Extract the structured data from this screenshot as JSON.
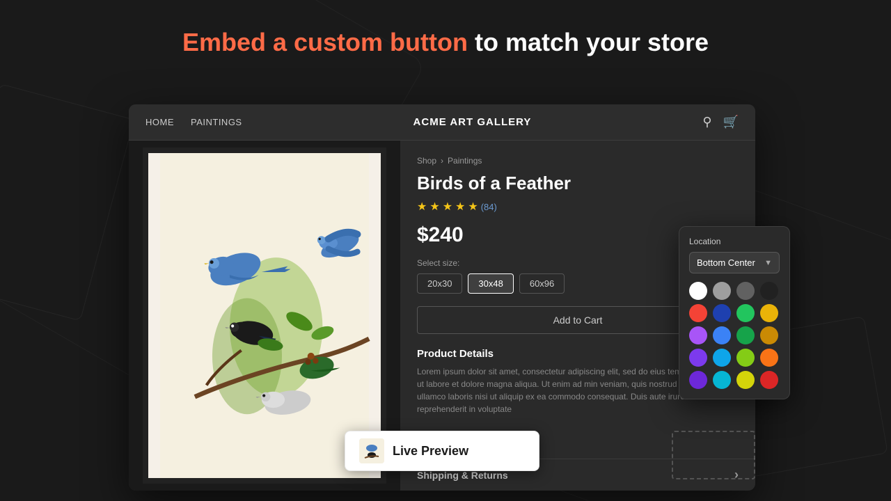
{
  "page": {
    "background_color": "#1a1a1a"
  },
  "hero": {
    "title_accent": "Embed a custom button",
    "title_rest": " to match your store"
  },
  "store": {
    "nav": {
      "link1": "HOME",
      "link2": "PAINTINGS",
      "title": "ACME ART GALLERY"
    },
    "product": {
      "breadcrumb_shop": "Shop",
      "breadcrumb_sep": "›",
      "breadcrumb_cat": "Paintings",
      "title": "Birds of a Feather",
      "reviews": "(84)",
      "price": "$240",
      "size_label": "Select size:",
      "sizes": [
        "20x30",
        "30x48",
        "60x96"
      ],
      "active_size": "30x48",
      "add_to_cart": "Add to Cart",
      "details_title": "Product Details",
      "description": "Lorem ipsum dolor sit amet, consectetur adipiscing elit, sed do eius tempor incididunt ut labore et dolore magna aliqua. Ut enim ad min veniam, quis nostrud exercitation ullamco laboris nisi ut aliquip ex ea commodo consequat. Duis aute irure dolor in reprehenderit in voluptate",
      "shipping": "Shipping & Returns"
    }
  },
  "live_preview": {
    "label": "Live Preview"
  },
  "color_panel": {
    "location_label": "Location",
    "selected_location": "Bottom Center",
    "colors": [
      {
        "hex": "#ffffff",
        "selected": true
      },
      {
        "hex": "#9e9e9e",
        "selected": false
      },
      {
        "hex": "#616161",
        "selected": false
      },
      {
        "hex": "#212121",
        "selected": false
      },
      {
        "hex": "#f44336",
        "selected": false
      },
      {
        "hex": "#1e40af",
        "selected": false
      },
      {
        "hex": "#22c55e",
        "selected": false
      },
      {
        "hex": "#eab308",
        "selected": false
      },
      {
        "hex": "#a855f7",
        "selected": false
      },
      {
        "hex": "#3b82f6",
        "selected": false
      },
      {
        "hex": "#16a34a",
        "selected": false
      },
      {
        "hex": "#ca8a04",
        "selected": false
      },
      {
        "hex": "#7c3aed",
        "selected": false
      },
      {
        "hex": "#0ea5e9",
        "selected": false
      },
      {
        "hex": "#84cc16",
        "selected": false
      },
      {
        "hex": "#f97316",
        "selected": false
      },
      {
        "hex": "#6d28d9",
        "selected": false
      },
      {
        "hex": "#06b6d4",
        "selected": false
      },
      {
        "hex": "#d4d40a",
        "selected": false
      },
      {
        "hex": "#dc2626",
        "selected": false
      }
    ]
  }
}
